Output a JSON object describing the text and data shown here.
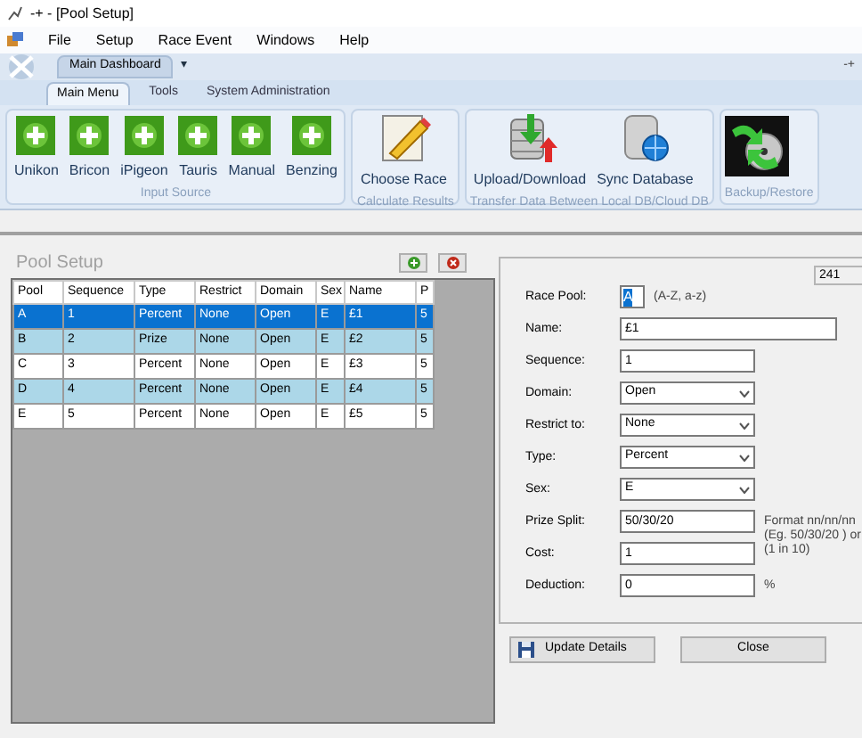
{
  "window": {
    "title": "-+ - [Pool Setup]"
  },
  "menu": [
    "File",
    "Setup",
    "Race Event",
    "Windows",
    "Help"
  ],
  "document_tab": {
    "label": "Main Dashboard",
    "dropdown": "▾",
    "controls": "-+"
  },
  "ribbon_tabs": [
    {
      "label": "Main Menu",
      "selected": true
    },
    {
      "label": "Tools",
      "selected": false
    },
    {
      "label": "System Administration",
      "selected": false
    }
  ],
  "ribbon_groups": [
    {
      "label": "Input Source",
      "buttons": [
        {
          "label": "Unikon",
          "kind": "plus"
        },
        {
          "label": "Bricon",
          "kind": "plus"
        },
        {
          "label": "iPigeon",
          "kind": "plus"
        },
        {
          "label": "Tauris",
          "kind": "plus"
        },
        {
          "label": "Manual",
          "kind": "plus"
        },
        {
          "label": "Benzing",
          "kind": "plus"
        }
      ]
    },
    {
      "label": "Calculate Results",
      "buttons": [
        {
          "label": "Choose Race",
          "kind": "pencil"
        }
      ]
    },
    {
      "label": "Transfer Data Between Local DB/Cloud  DB",
      "buttons": [
        {
          "label": "Upload/Download",
          "kind": "transfer"
        },
        {
          "label": "Sync Database",
          "kind": "sync"
        }
      ]
    },
    {
      "label": "Backup/Restore",
      "buttons": [
        {
          "kind": "backup"
        }
      ]
    }
  ],
  "pool_panel": {
    "title": "Pool Setup",
    "table": {
      "columns": [
        "Pool",
        "Sequence",
        "Type",
        "Restrict",
        "Domain",
        "Sex",
        "Name",
        "P"
      ],
      "rows": [
        {
          "cells": [
            "A",
            "1",
            "Percent",
            "None",
            "Open",
            "E",
            "£1",
            "5"
          ],
          "selected": true
        },
        {
          "cells": [
            "B",
            "2",
            "Prize",
            "None",
            "Open",
            "E",
            "£2",
            "5"
          ],
          "selected": false
        },
        {
          "cells": [
            "C",
            "3",
            "Percent",
            "None",
            "Open",
            "E",
            "£3",
            "5"
          ],
          "selected": false
        },
        {
          "cells": [
            "D",
            "4",
            "Percent",
            "None",
            "Open",
            "E",
            "£4",
            "5"
          ],
          "selected": false
        },
        {
          "cells": [
            "E",
            "5",
            "Percent",
            "None",
            "Open",
            "E",
            "£5",
            "5"
          ],
          "selected": false
        }
      ]
    }
  },
  "form": {
    "record_id": "241",
    "fields": [
      {
        "label": "Race Pool:",
        "kind": "letter",
        "value": "A",
        "hint": "(A-Z, a-z)"
      },
      {
        "label": "Name:",
        "kind": "wide",
        "value": "£1"
      },
      {
        "label": "Sequence:",
        "kind": "text",
        "value": "1"
      },
      {
        "label": "Domain:",
        "kind": "select",
        "value": "Open"
      },
      {
        "label": "Restrict to:",
        "kind": "select",
        "value": "None"
      },
      {
        "label": "Type:",
        "kind": "select",
        "value": "Percent"
      },
      {
        "label": "Sex:",
        "kind": "select",
        "value": "E"
      },
      {
        "label": "Prize Split:",
        "kind": "text",
        "value": "50/30/20",
        "hint": "Format nn/nn/nn (Eg. 50/30/20 ) or (1 in 10)"
      },
      {
        "label": "Cost:",
        "kind": "text",
        "value": "1"
      },
      {
        "label": "Deduction:",
        "kind": "text",
        "value": "0",
        "hint": "%"
      }
    ],
    "buttons": [
      {
        "label": "Update Details",
        "kind": "save"
      },
      {
        "label": "Close",
        "kind": "plain"
      }
    ]
  }
}
